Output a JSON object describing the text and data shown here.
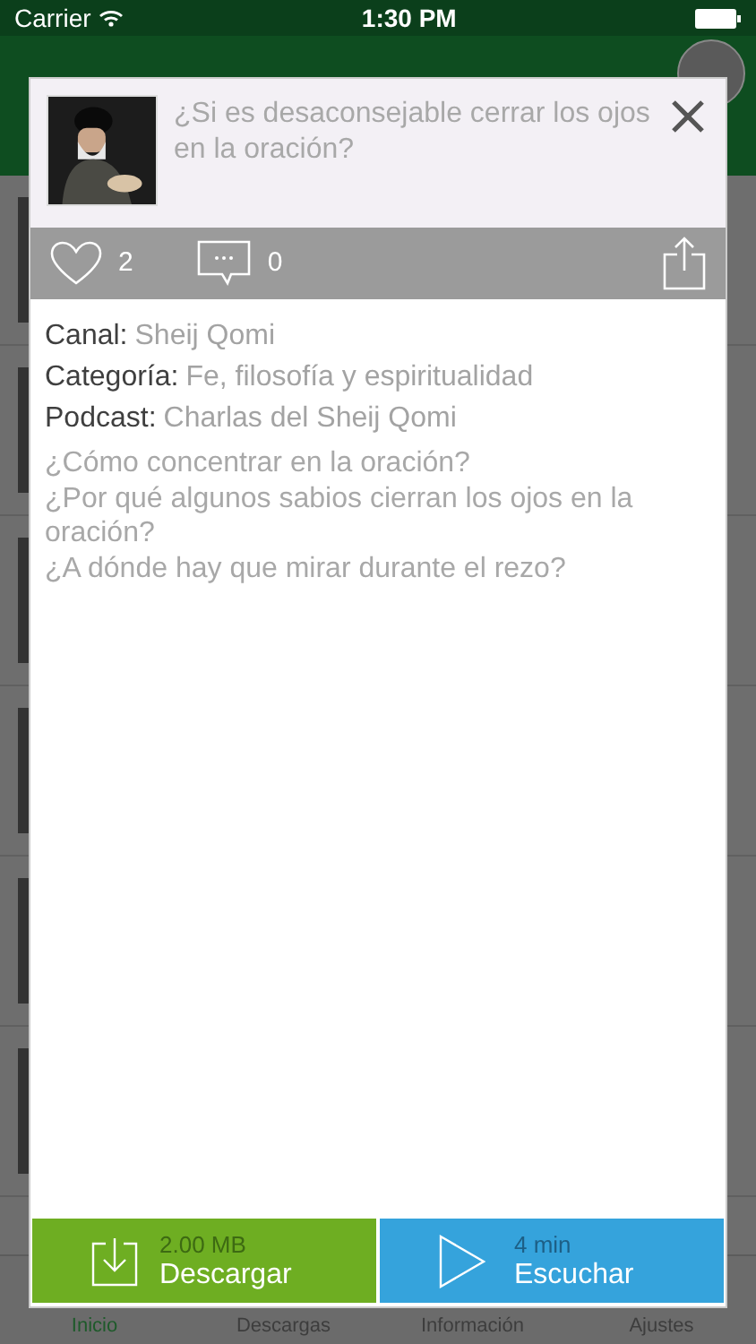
{
  "status_bar": {
    "carrier": "Carrier",
    "time": "1:30 PM"
  },
  "modal": {
    "title": "¿Si es desaconsejable cerrar los ojos en la oración?",
    "likes": "2",
    "comments": "0",
    "fields": [
      {
        "label": "Canal:",
        "value": "Sheij Qomi"
      },
      {
        "label": "Categoría:",
        "value": "Fe, filosofía y espiritualidad"
      },
      {
        "label": "Podcast:",
        "value": "Charlas del Sheij Qomi"
      }
    ],
    "description": "¿Cómo concentrar en la oración?\n¿Por qué algunos sabios cierran los ojos en la oración?\n¿A dónde hay que mirar durante el rezo?",
    "download": {
      "size": "2.00 MB",
      "label": "Descargar"
    },
    "listen": {
      "duration": "4 min",
      "label": "Escuchar"
    }
  },
  "tabs": [
    {
      "label": "Inicio",
      "selected": true
    },
    {
      "label": "Descargas",
      "selected": false
    },
    {
      "label": "Información",
      "selected": false
    },
    {
      "label": "Ajustes",
      "selected": false
    }
  ]
}
